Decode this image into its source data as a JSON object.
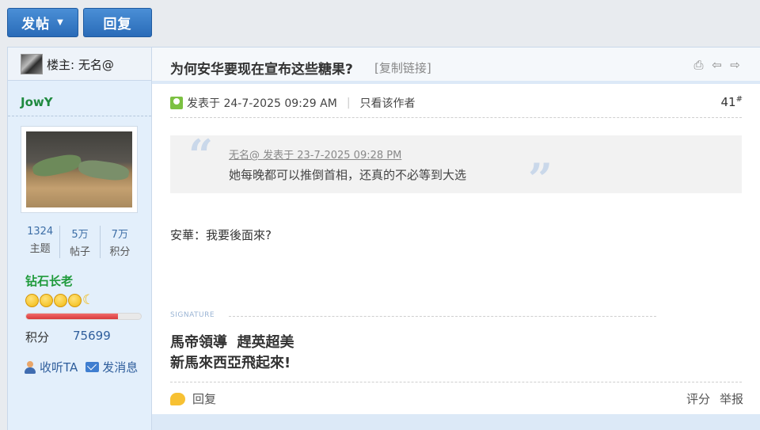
{
  "toolbar": {
    "post_label": "发帖",
    "reply_label": "回复"
  },
  "thread_owner": {
    "label": "楼主: 无名@"
  },
  "user": {
    "name": "JowY",
    "stats": [
      {
        "num": "1324",
        "label": "主题"
      },
      {
        "num": "5万",
        "label": "帖子"
      },
      {
        "num": "7万",
        "label": "积分"
      }
    ],
    "rank": "钻石长老",
    "rank_progress": 0.8,
    "points_label": "积分",
    "points_value": "75699",
    "follow_label": "收听TA",
    "message_label": "发消息"
  },
  "thread": {
    "title": "为何安华要现在宣布这些糖果?",
    "copy_link": "[复制链接]"
  },
  "post": {
    "posted_at": "发表于 24-7-2025 09:29 AM",
    "only_author": "只看该作者",
    "floor": "41",
    "floor_mark": "#",
    "quote_head": "无名@ 发表于 23-7-2025 09:28 PM",
    "quote_body": "她每晚都可以推倒首相，还真的不必等到大选",
    "body": "安華：我要後面來?",
    "signature_label": "SIGNATURE",
    "signature_line1": "馬帝領導  趕英超美",
    "signature_line2": "新馬來西亞飛起來!",
    "reply_label": "回复",
    "rate_label": "评分",
    "report_label": "举报"
  },
  "colors": {
    "button_blue": "#2a6bb8",
    "username_green": "#1f8a3f",
    "rank_green": "#1e9a3a",
    "progress_red": "#d83b3b"
  }
}
